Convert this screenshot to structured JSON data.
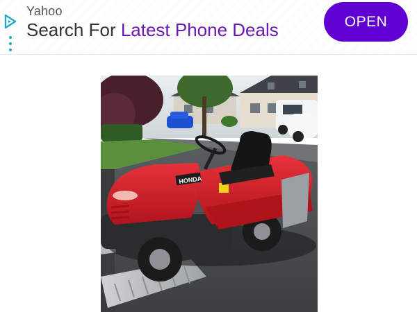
{
  "ad": {
    "advertiser": "Yahoo",
    "headline_prefix": "Search For ",
    "headline_highlight": "Latest Phone Deals",
    "cta_label": "OPEN",
    "cta_color": "#6001d2",
    "highlight_color": "#6a1bb3",
    "icons": [
      "adchoices-icon",
      "ad-menu-icon"
    ]
  },
  "photo": {
    "subject": "ride-on-mower-photo",
    "brand_decal": "HONDA"
  }
}
